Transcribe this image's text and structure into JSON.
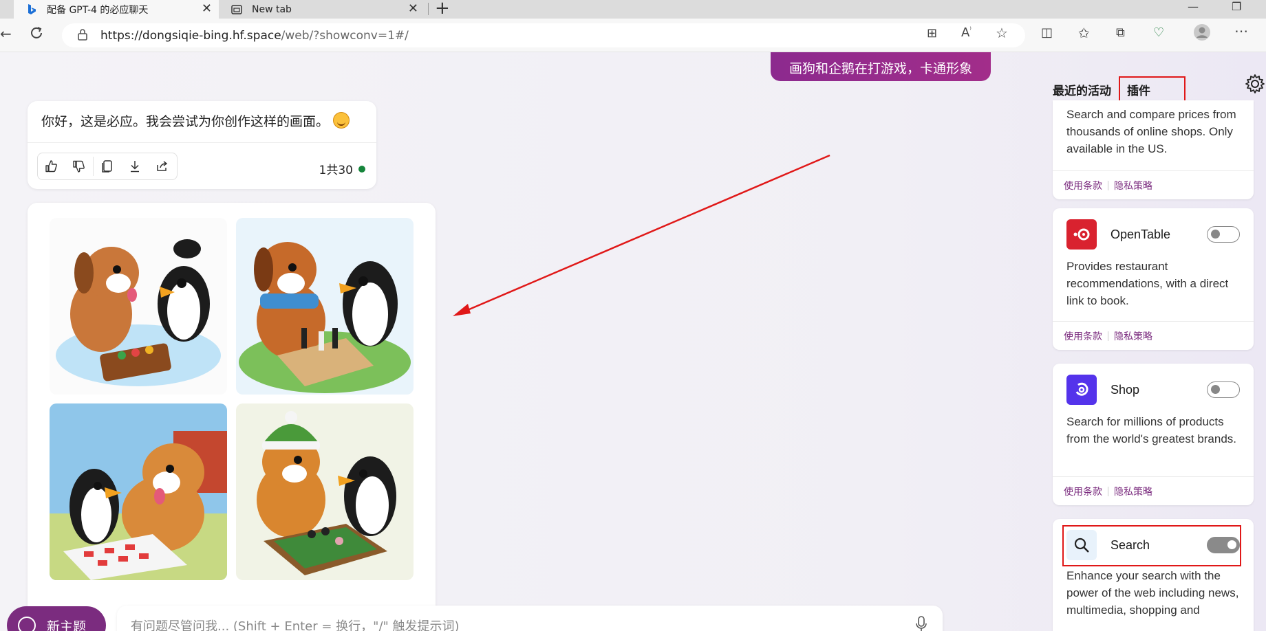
{
  "browser": {
    "tabs": [
      {
        "title": "配备 GPT-4 的必应聊天",
        "active": true
      },
      {
        "title": "New tab",
        "active": false
      }
    ],
    "url_host": "https://dongsiqie-bing.hf.space",
    "url_path": "/web/?showconv=1#/"
  },
  "chat": {
    "user_message": "画狗和企鹅在打游戏，卡通形象",
    "bot_message": "你好，这是必应。我会尝试为你创作这样的画面。",
    "counter": "1共30",
    "action_icons": [
      "thumbs-up-icon",
      "thumbs-down-icon",
      "copy-icon",
      "download-icon",
      "share-icon"
    ],
    "input_placeholder": "有问题尽管问我... (Shift + Enter = 换行，\"/\" 触发提示词)",
    "new_topic_label": "新主题"
  },
  "panel": {
    "tab_recent": "最近的活动",
    "tab_plugins": "插件",
    "first_card_desc": "Search and compare prices from thousands of online shops. Only available in the US.",
    "terms_label": "使用条款",
    "privacy_label": "隐私策略",
    "plugins": [
      {
        "name": "OpenTable",
        "desc": "Provides restaurant recommendations, with a direct link to book.",
        "enabled": false,
        "color": "#d9222f"
      },
      {
        "name": "Shop",
        "desc": "Search for millions of products from the world's greatest brands.",
        "enabled": false,
        "color": "#5433eb"
      },
      {
        "name": "Search",
        "desc": "Enhance your search with the power of the web including news, multimedia, shopping and",
        "enabled": true,
        "color": "#e8f2fb"
      }
    ]
  },
  "colors": {
    "accent": "#7b2c7f",
    "annotation": "#e01818"
  }
}
